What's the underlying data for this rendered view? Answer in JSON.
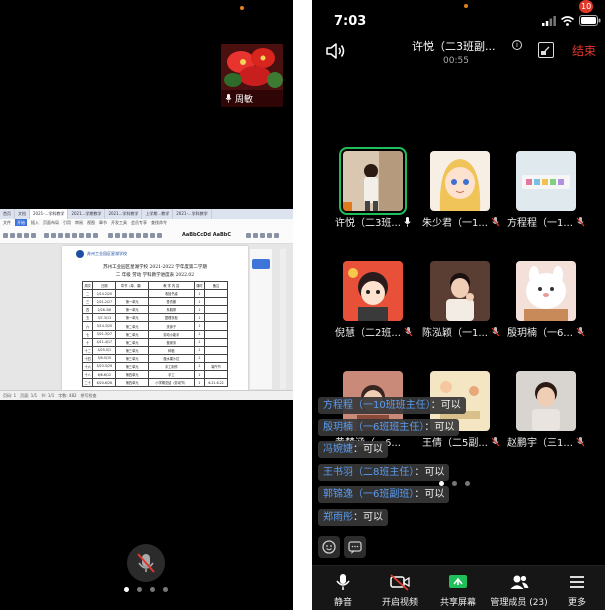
{
  "left_phone": {
    "pip_name": "周敏",
    "shared_doc": {
      "tabs": [
        "首页",
        "文档",
        "2021-...学科教学",
        "2021...学期教学",
        "2021...学科教学",
        "上学期...教学",
        "2021-...学科教学"
      ],
      "menus": [
        "文件",
        "开始",
        "插入",
        "页面布局",
        "引用",
        "审阅",
        "视图",
        "章节",
        "开发工具",
        "会员专享",
        "查找命令"
      ],
      "font_sample": "AaBbCcDd AaBbC",
      "school_name": "苏州工业园区星湖学校",
      "title_line1": "苏州工业园区星湖学校 2021-2022 学年度第二学期",
      "title_line2": "二 年级  劳动  学科教学进度表        2022.02",
      "table_headers": [
        "周次",
        "日期",
        "章节（单、课）",
        "教 学 内 容",
        "课时",
        "备注"
      ],
      "table_rows": [
        [
          "二",
          "2/14-2/20",
          "",
          "收拾书桌",
          "1",
          ""
        ],
        [
          "三",
          "2/21-2/27",
          "第一单元",
          "叠衣服",
          "1",
          ""
        ],
        [
          "四",
          "2/28-3/6",
          "第一单元",
          "系鞋带",
          "1",
          ""
        ],
        [
          "五",
          "3/7-3/13",
          "第一单元",
          "整理衣柜",
          "1",
          ""
        ],
        [
          "六",
          "3/14-3/20",
          "第二单元",
          "洗袜子",
          "1",
          ""
        ],
        [
          "七",
          "3/21-3/27",
          "第二单元",
          "劳动小能手",
          "1",
          ""
        ],
        [
          "十",
          "4/11-4/17",
          "第二单元",
          "做家务",
          "1",
          ""
        ],
        [
          "十二",
          "4/25-5/1",
          "第三单元",
          "种植",
          "1",
          ""
        ],
        [
          "十四",
          "5/9-5/15",
          "第三单元",
          "做水果沙拉",
          "1",
          ""
        ],
        [
          "十六",
          "5/23-5/29",
          "第三单元",
          "手工制作",
          "1",
          "端午节"
        ],
        [
          "十八",
          "6/6-6/12",
          "第四单元",
          "手工",
          "1",
          ""
        ],
        [
          "二十",
          "6/20-6/26",
          "第四单元",
          "小学期总结（劳动节）",
          "1",
          "6.21-6.22"
        ]
      ],
      "status_items": [
        "页码: 1",
        "页面: 1/1",
        "节: 1/1",
        "字数: 482",
        "拼写检查"
      ]
    }
  },
  "right_phone": {
    "status_time": "7:03",
    "meeting_title": "许悦（二3班副...",
    "meeting_timer": "00:55",
    "end_label": "结束",
    "tiles": [
      {
        "label": "许悦（二3班..."
      },
      {
        "label": "朱少君（一1..."
      },
      {
        "label": "方程程（一1..."
      },
      {
        "label": "倪慧（二2班..."
      },
      {
        "label": "陈泓颖（一1..."
      },
      {
        "label": "殷玥楠（一6..."
      },
      {
        "label": "黄楚涵（一6..."
      },
      {
        "label": "王倩（二5副..."
      },
      {
        "label": "赵鹏宇（三1..."
      }
    ],
    "chat": [
      {
        "who": "方程程（一10班班主任）",
        "msg": "：可以"
      },
      {
        "who": "殷玥楠（一6班班主任）",
        "msg": "：可以"
      },
      {
        "who": "冯婉婕",
        "msg": "：可以"
      },
      {
        "who": "王书羽（二8班主任）",
        "msg": "：可以"
      },
      {
        "who": "郭锦逸（一6班副班）",
        "msg": "：可以"
      },
      {
        "who": "郑雨彤",
        "msg": "：可以"
      }
    ],
    "bottom_bar": {
      "mute": "静音",
      "video": "开启视频",
      "share": "共享屏幕",
      "members": "管理成员 (23)",
      "more": "更多",
      "more_badge": "10"
    }
  }
}
